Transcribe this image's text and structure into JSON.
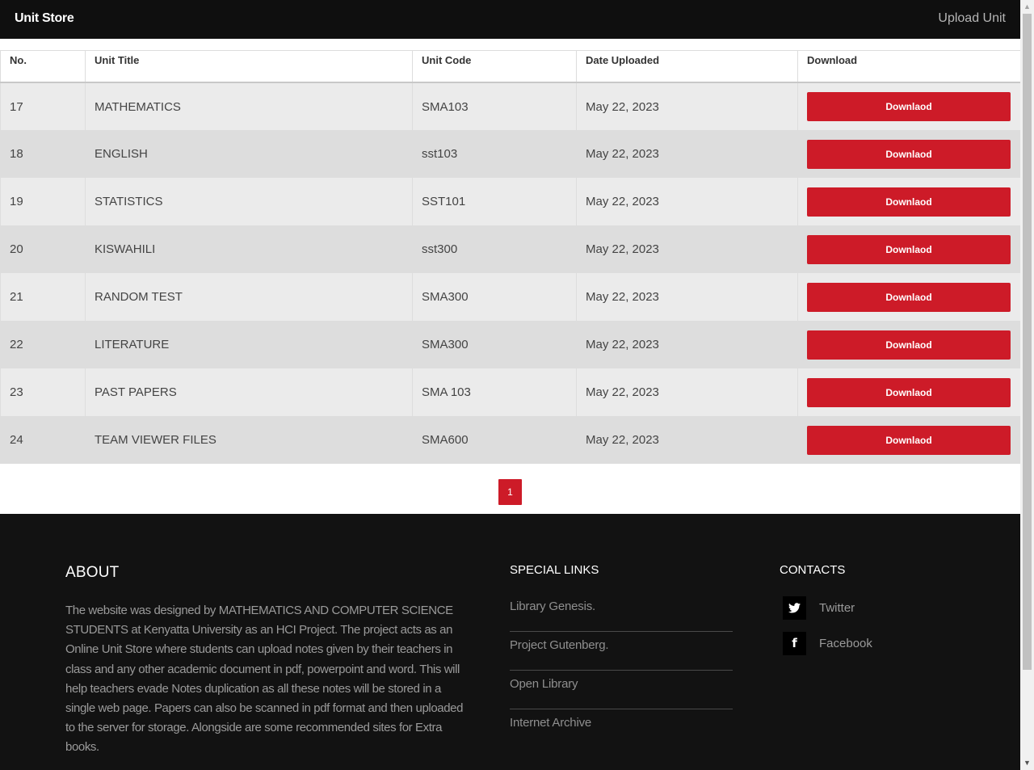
{
  "navbar": {
    "brand": "Unit Store",
    "upload_link": "Upload Unit"
  },
  "table": {
    "headers": [
      "No.",
      "Unit Title",
      "Unit Code",
      "Date Uploaded",
      "Download"
    ],
    "rows": [
      {
        "no": "17",
        "title": "MATHEMATICS",
        "code": "SMA103",
        "date": "May 22, 2023",
        "button": "Downlaod"
      },
      {
        "no": "18",
        "title": "ENGLISH",
        "code": "sst103",
        "date": "May 22, 2023",
        "button": "Downlaod"
      },
      {
        "no": "19",
        "title": "STATISTICS",
        "code": "SST101",
        "date": "May 22, 2023",
        "button": "Downlaod"
      },
      {
        "no": "20",
        "title": "KISWAHILI",
        "code": "sst300",
        "date": "May 22, 2023",
        "button": "Downlaod"
      },
      {
        "no": "21",
        "title": "RANDOM TEST",
        "code": "SMA300",
        "date": "May 22, 2023",
        "button": "Downlaod"
      },
      {
        "no": "22",
        "title": "LITERATURE",
        "code": "SMA300",
        "date": "May 22, 2023",
        "button": "Downlaod"
      },
      {
        "no": "23",
        "title": "PAST PAPERS",
        "code": "SMA 103",
        "date": "May 22, 2023",
        "button": "Downlaod"
      },
      {
        "no": "24",
        "title": "TEAM VIEWER FILES",
        "code": "SMA600",
        "date": "May 22, 2023",
        "button": "Downlaod"
      }
    ]
  },
  "pagination": {
    "current_page": "1"
  },
  "footer": {
    "about": {
      "title": "ABOUT",
      "text": "The website was designed by MATHEMATICS AND COMPUTER SCIENCE STUDENTS at Kenyatta University as an HCI Project. The project acts as an Online Unit Store where students can upload notes given by their teachers in class and any other academic document in pdf, powerpoint and word. This will help teachers evade Notes duplication as all these notes will be stored in a single web page. Papers can also be scanned in pdf format and then uploaded to the server for storage. Alongside are some recommended sites for Extra books."
    },
    "special_links": {
      "title": "SPECIAL LINKS",
      "items": [
        "Library Genesis.",
        "Project Gutenberg.",
        "Open Library",
        "Internet Archive"
      ]
    },
    "contacts": {
      "title": "CONTACTS",
      "items": [
        {
          "label": "Twitter",
          "icon": "twitter-icon",
          "glyph": "★"
        },
        {
          "label": "Facebook",
          "icon": "facebook-icon",
          "glyph": "f"
        }
      ]
    }
  },
  "colors": {
    "navbar_bg": "#0f0f0f",
    "accent_red": "#cd1b28",
    "footer_bg": "#121212"
  }
}
